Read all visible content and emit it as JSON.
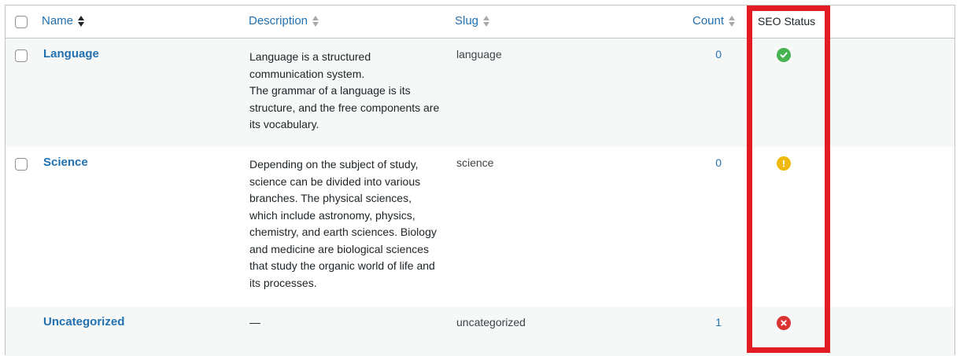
{
  "columns": {
    "name": "Name",
    "description": "Description",
    "slug": "Slug",
    "count": "Count",
    "seo_status": "SEO Status"
  },
  "rows": [
    {
      "name": "Language",
      "description": [
        "Language is a structured communication system.",
        "The grammar of a language is its structure, and the free components are its vocabulary."
      ],
      "slug": "language",
      "count": "0",
      "seo_status": "good",
      "status_icon": "check-circle-icon",
      "status_color": "#46b450",
      "has_checkbox": true
    },
    {
      "name": "Science",
      "description": [
        "Depending on the subject of study, science can be divided into various branches. The physical sciences, which include astronomy, physics, chemistry, and earth sciences. Biology and medicine are biological sciences that study the organic world of life and its processes."
      ],
      "slug": "science",
      "count": "0",
      "seo_status": "warning",
      "status_icon": "exclamation-circle-icon",
      "status_color": "#f0b90b",
      "has_checkbox": true
    },
    {
      "name": "Uncategorized",
      "description": [
        "—"
      ],
      "slug": "uncategorized",
      "count": "1",
      "seo_status": "error",
      "status_icon": "x-circle-icon",
      "status_color": "#dc3232",
      "has_checkbox": false
    }
  ],
  "colors": {
    "link": "#2271b1",
    "highlight_border": "#e31b23",
    "alt_row": "#f6f7f7"
  }
}
